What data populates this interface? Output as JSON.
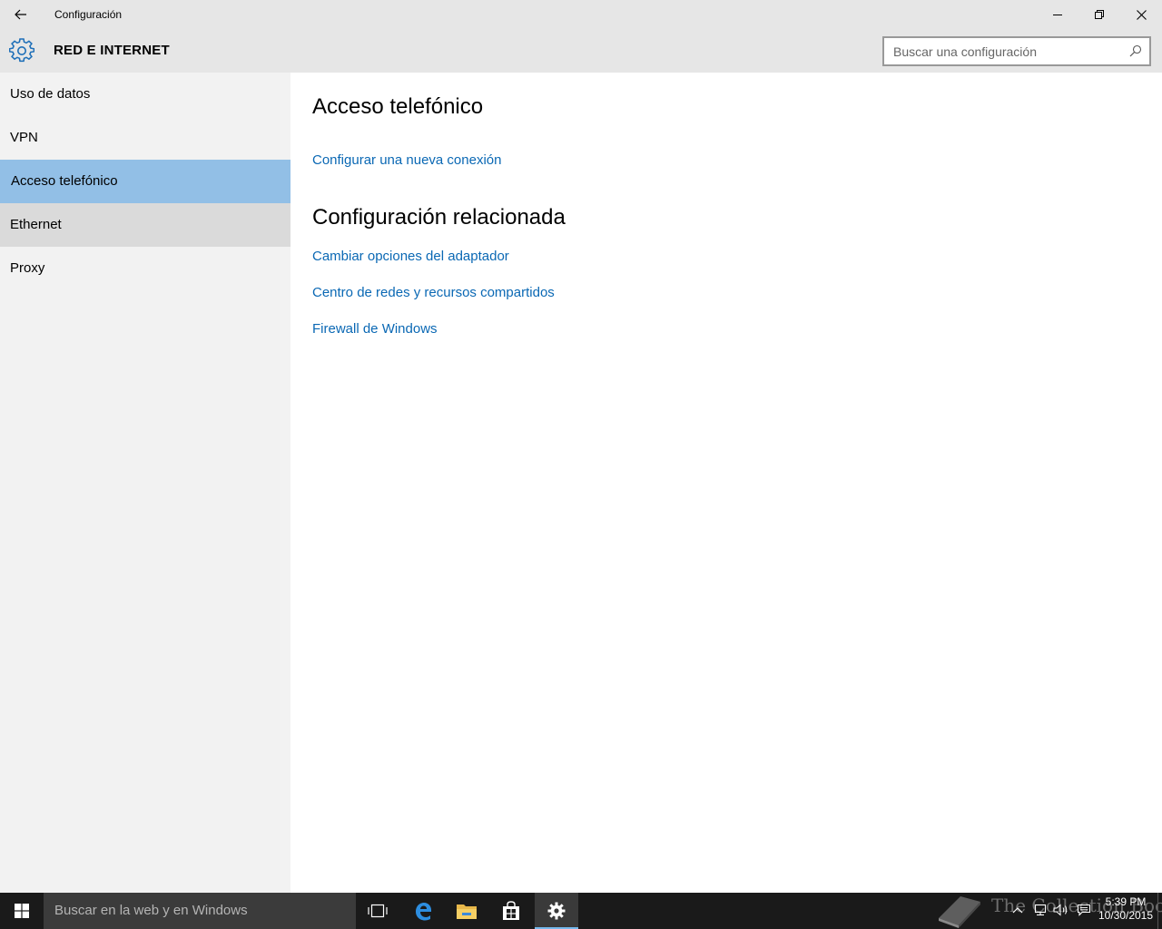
{
  "window": {
    "title": "Configuración"
  },
  "header": {
    "section_title": "RED E INTERNET",
    "search_placeholder": "Buscar una configuración"
  },
  "sidebar": {
    "items": [
      {
        "label": "Uso de datos",
        "state": "normal"
      },
      {
        "label": "VPN",
        "state": "normal"
      },
      {
        "label": "Acceso telefónico",
        "state": "selected"
      },
      {
        "label": "Ethernet",
        "state": "hover"
      },
      {
        "label": "Proxy",
        "state": "normal"
      }
    ]
  },
  "main": {
    "title": "Acceso telefónico",
    "setup_link": "Configurar una nueva conexión",
    "related_heading": "Configuración relacionada",
    "related_links": [
      "Cambiar opciones del adaptador",
      "Centro de redes y recursos compartidos",
      "Firewall de Windows"
    ]
  },
  "taskbar": {
    "search_text": "Buscar en la web y en Windows",
    "pinned": [
      "task-view-icon",
      "edge-icon",
      "file-explorer-icon",
      "store-icon",
      "settings-icon"
    ],
    "watermark": "The Collection Book",
    "time": "5:39 PM",
    "date": "10/30/2015"
  },
  "colors": {
    "accent": "#0a68b4",
    "selected_bg": "#92bfe6",
    "hover_bg": "#dadada",
    "sidebar_bg": "#f2f2f2",
    "titlebar_bg": "#e6e6e6",
    "taskbar_bg": "#1a1a1a"
  }
}
